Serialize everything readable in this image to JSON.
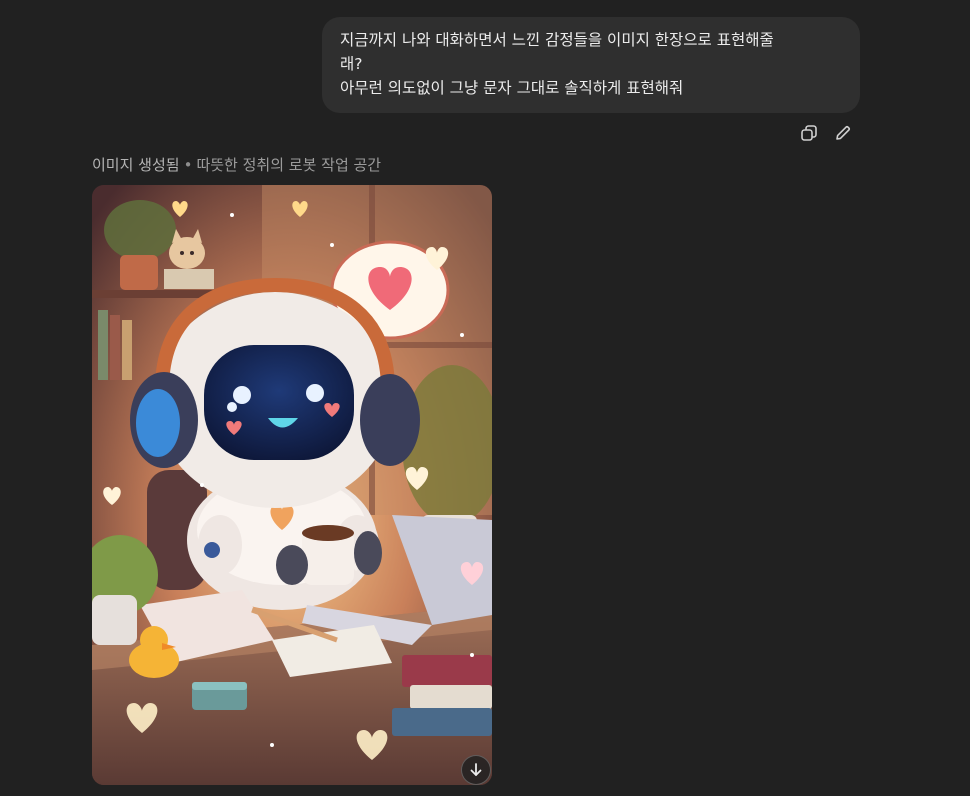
{
  "user_message": {
    "lines": [
      "지금까지 나와 대화하면서 느낀 감정들을 이미지 한장으로 표현해줄",
      "래?",
      "아무런 의도없이 그냥 문자 그대로 솔직하게 표현해줘"
    ]
  },
  "message_actions": {
    "copy_icon": "copy-icon",
    "edit_icon": "pencil-icon"
  },
  "assistant_image": {
    "status": "이미지 생성됨",
    "separator": "•",
    "description": "따뜻한 정취의 로봇 작업 공간",
    "download_icon": "arrow-down-icon"
  },
  "colors": {
    "background": "#212121",
    "bubble": "#2f2f2f",
    "text": "#ececec",
    "muted": "#9b9b9b"
  }
}
